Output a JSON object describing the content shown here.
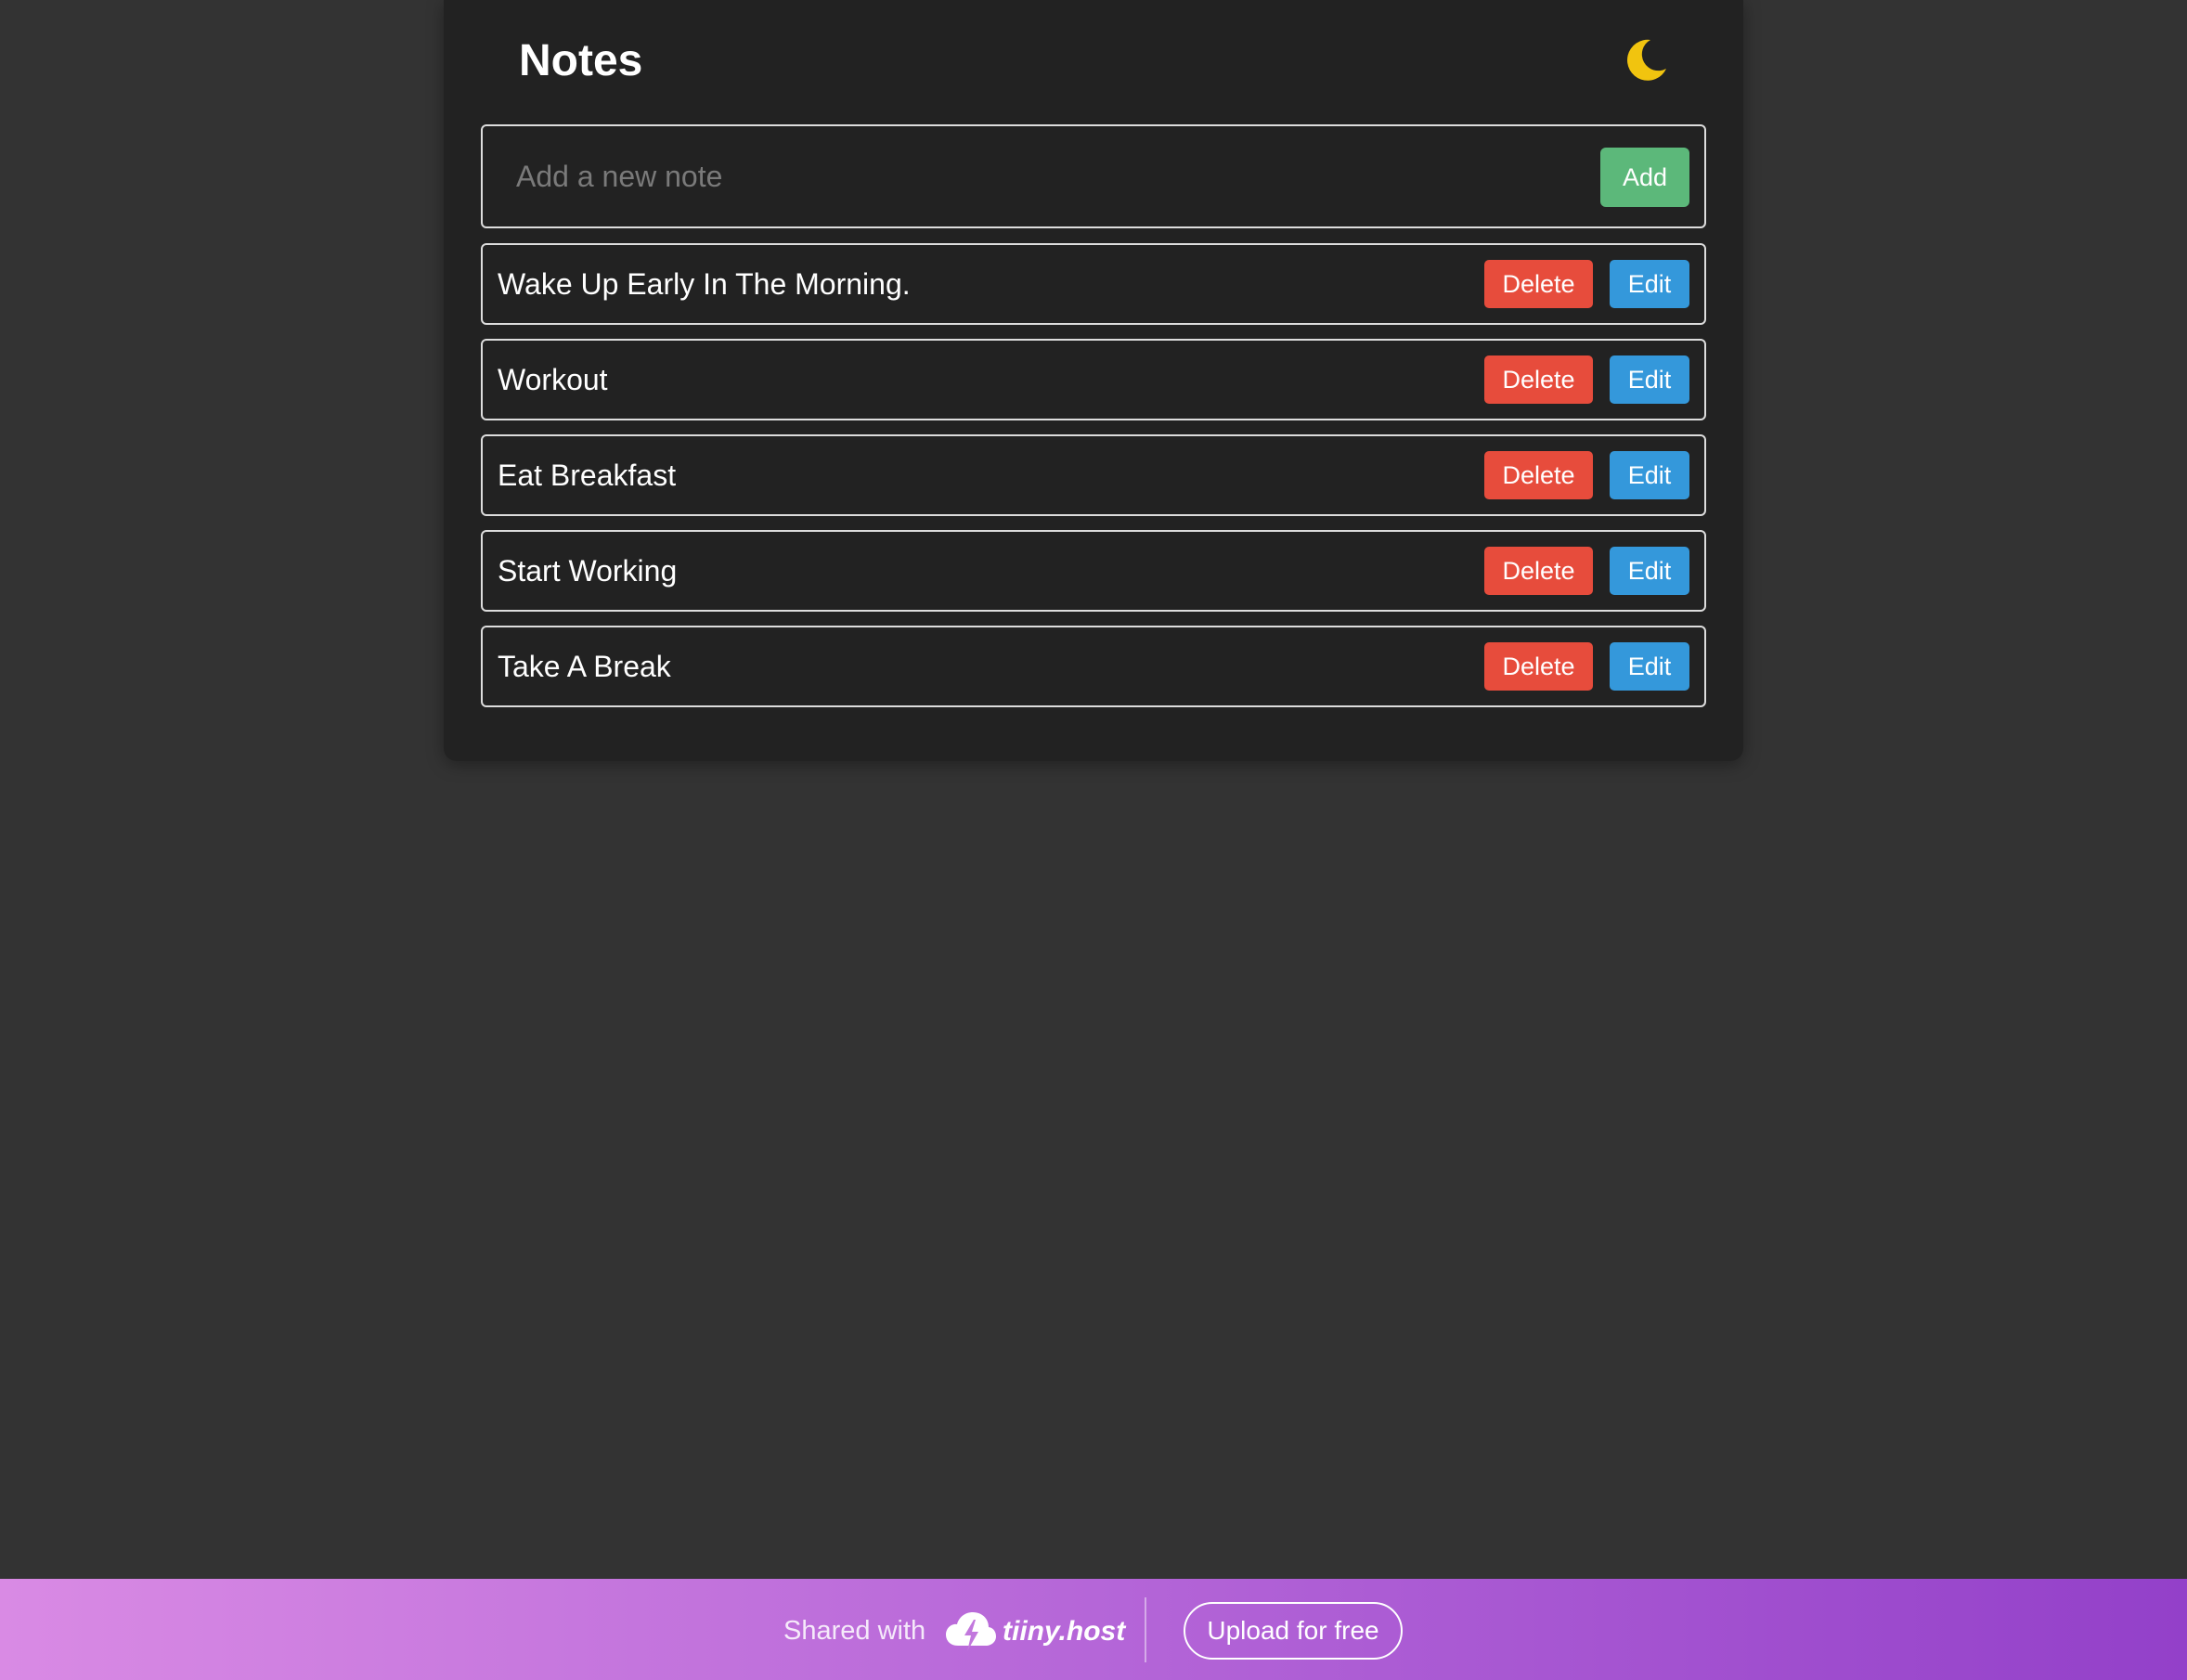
{
  "header": {
    "title": "Notes",
    "theme_icon": "moon-icon"
  },
  "new_note": {
    "placeholder": "Add a new note",
    "value": "",
    "add_label": "Add"
  },
  "notes": [
    {
      "text": "Wake Up Early In The Morning.",
      "delete_label": "Delete",
      "edit_label": "Edit"
    },
    {
      "text": "Workout",
      "delete_label": "Delete",
      "edit_label": "Edit"
    },
    {
      "text": "Eat Breakfast",
      "delete_label": "Delete",
      "edit_label": "Edit"
    },
    {
      "text": "Start Working",
      "delete_label": "Delete",
      "edit_label": "Edit"
    },
    {
      "text": "Take A Break",
      "delete_label": "Delete",
      "edit_label": "Edit"
    }
  ],
  "footer": {
    "shared_text": "Shared with",
    "brand_name": "tiiny.host",
    "brand_icon": "cloud-bolt-icon",
    "upload_label": "Upload for free"
  },
  "colors": {
    "page_background": "#333333",
    "card_background": "#222222",
    "add_button": "#5cb87a",
    "delete_button": "#e74c3c",
    "edit_button": "#3498db",
    "moon_icon": "#f1c40f"
  }
}
